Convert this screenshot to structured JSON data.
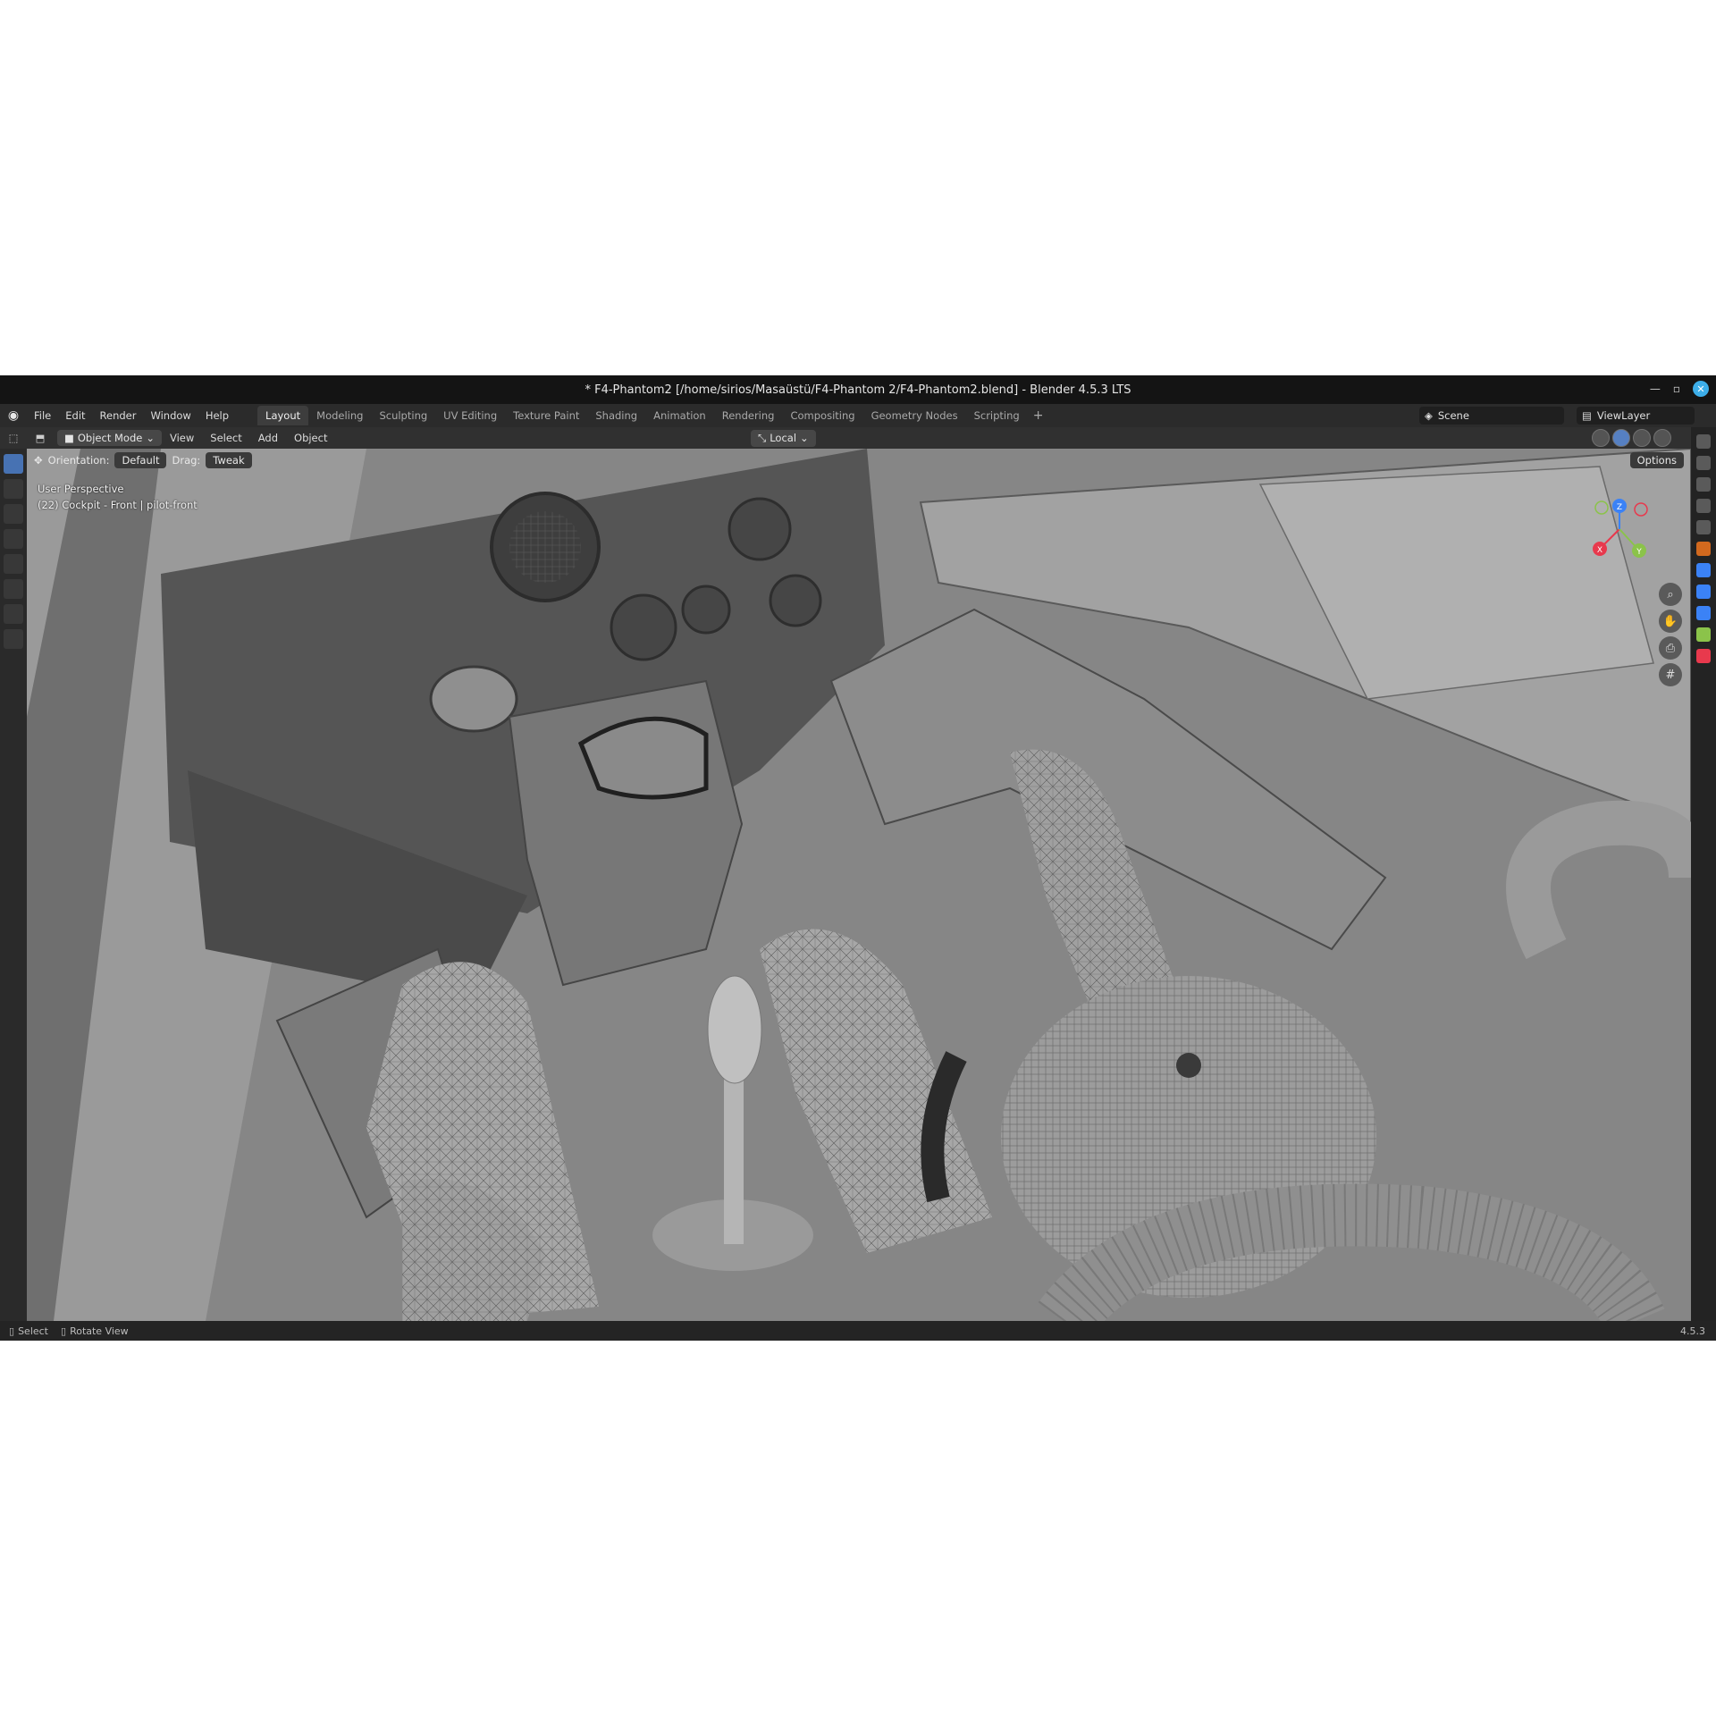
{
  "window": {
    "title": "* F4-Phantom2 [/home/sirios/Masaüstü/F4-Phantom 2/F4-Phantom2.blend] - Blender 4.5.3 LTS"
  },
  "menu": [
    "File",
    "Edit",
    "Render",
    "Window",
    "Help"
  ],
  "workspaces": [
    "Layout",
    "Modeling",
    "Sculpting",
    "UV Editing",
    "Texture Paint",
    "Shading",
    "Animation",
    "Rendering",
    "Compositing",
    "Geometry Nodes",
    "Scripting"
  ],
  "active_workspace": "Layout",
  "scene": {
    "name": "Scene",
    "view_layer": "ViewLayer"
  },
  "header": {
    "mode": "Object Mode",
    "menus": [
      "View",
      "Select",
      "Add",
      "Object"
    ],
    "transform_orientation": "Local"
  },
  "tool_settings": {
    "orientation_label": "Orientation:",
    "orientation_value": "Default",
    "drag_label": "Drag:",
    "drag_value": "Tweak",
    "options_label": "Options"
  },
  "viewport": {
    "perspective": "User Perspective",
    "object_info": "(22) Cockpit - Front | pilot-front",
    "gizmo_axes": {
      "x": "X",
      "y": "Y",
      "z": "Z"
    }
  },
  "status": {
    "left_mouse": "Select",
    "middle_mouse": "Rotate View",
    "version": "4.5.3"
  },
  "colors": {
    "axis_x": "#e8394d",
    "axis_y": "#8bc34a",
    "axis_z": "#3b82f6",
    "active_tool": "#4772b3"
  },
  "icons": [
    "blender-logo-icon",
    "move-icon",
    "zoom-icon",
    "hand-icon",
    "camera-icon",
    "grid-icon"
  ]
}
